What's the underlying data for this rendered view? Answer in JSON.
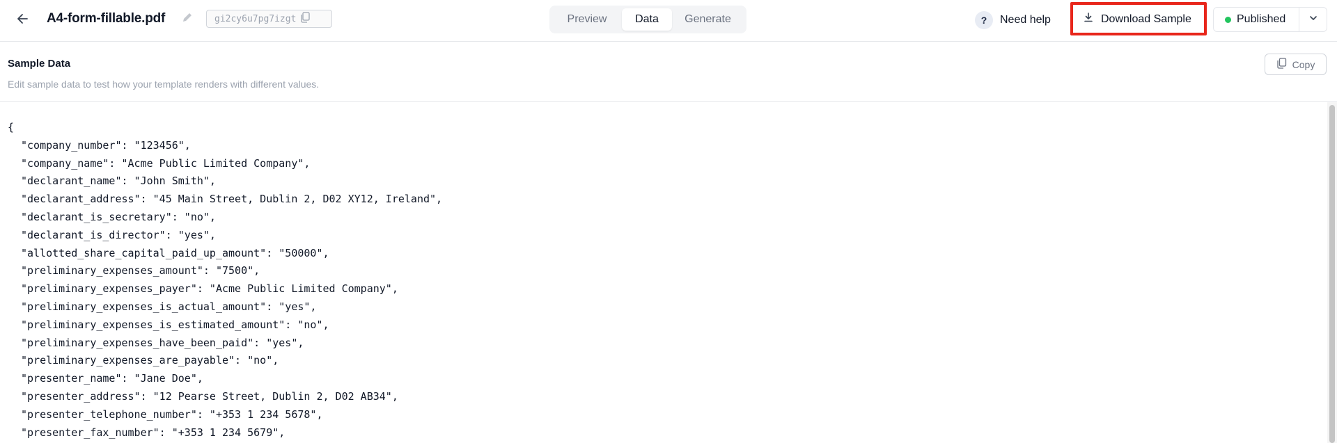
{
  "header": {
    "file_name": "A4-form-fillable.pdf",
    "template_id": "gi2cy6u7pg7izgt",
    "tabs": [
      {
        "label": "Preview",
        "active": false
      },
      {
        "label": "Data",
        "active": true
      },
      {
        "label": "Generate",
        "active": false
      }
    ],
    "help_label": "Need help",
    "help_symbol": "?",
    "download_label": "Download Sample",
    "status_label": "Published",
    "status_color": "#22c55e",
    "highlight_color": "#e8261b"
  },
  "section": {
    "title": "Sample Data",
    "description": "Edit sample data to test how your template renders with different values.",
    "copy_label": "Copy"
  },
  "editor": {
    "open_brace": "{",
    "lines": [
      "\"company_number\": \"123456\",",
      "\"company_name\": \"Acme Public Limited Company\",",
      "\"declarant_name\": \"John Smith\",",
      "\"declarant_address\": \"45 Main Street, Dublin 2, D02 XY12, Ireland\",",
      "\"declarant_is_secretary\": \"no\",",
      "\"declarant_is_director\": \"yes\",",
      "\"allotted_share_capital_paid_up_amount\": \"50000\",",
      "\"preliminary_expenses_amount\": \"7500\",",
      "\"preliminary_expenses_payer\": \"Acme Public Limited Company\",",
      "\"preliminary_expenses_is_actual_amount\": \"yes\",",
      "\"preliminary_expenses_is_estimated_amount\": \"no\",",
      "\"preliminary_expenses_have_been_paid\": \"yes\",",
      "\"preliminary_expenses_are_payable\": \"no\",",
      "\"presenter_name\": \"Jane Doe\",",
      "\"presenter_address\": \"12 Pearse Street, Dublin 2, D02 AB34\",",
      "\"presenter_telephone_number\": \"+353 1 234 5678\",",
      "\"presenter_fax_number\": \"+353 1 234 5679\","
    ]
  },
  "icons": {
    "back": "arrow-left-icon",
    "edit": "pencil-icon",
    "copy": "copy-icon",
    "download": "download-icon",
    "dropdown": "chevron-down-icon"
  }
}
